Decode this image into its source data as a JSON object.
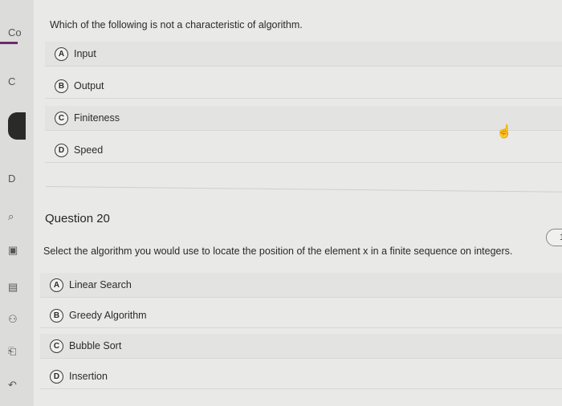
{
  "sidebar": {
    "items": [
      "Co",
      "C",
      "D"
    ]
  },
  "question19": {
    "prompt": "Which of the following is not a characteristic of algorithm.",
    "options": [
      {
        "letter": "A",
        "label": "Input"
      },
      {
        "letter": "B",
        "label": "Output"
      },
      {
        "letter": "C",
        "label": "Finiteness"
      },
      {
        "letter": "D",
        "label": "Speed"
      }
    ]
  },
  "question20": {
    "heading": "Question 20",
    "prompt": "Select the algorithm you would use to locate the position of the element x in a finite sequence on integers.",
    "options": [
      {
        "letter": "A",
        "label": "Linear Search"
      },
      {
        "letter": "B",
        "label": "Greedy Algorithm"
      },
      {
        "letter": "C",
        "label": "Bubble Sort"
      },
      {
        "letter": "D",
        "label": "Insertion"
      }
    ]
  },
  "right_pill": {
    "text": "1"
  },
  "icons": [
    "hand-pointer-icon"
  ]
}
